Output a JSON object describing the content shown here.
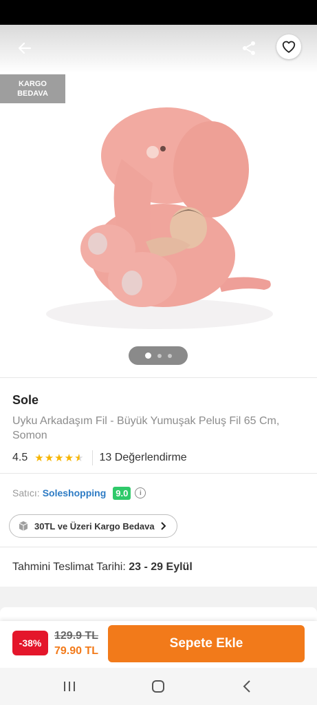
{
  "icons": {
    "back": "arrow-left-icon",
    "share": "share-icon",
    "favorite": "heart-icon",
    "cargo": "box-icon",
    "info": "info-icon"
  },
  "hero": {
    "badge_line1": "KARGO",
    "badge_line2": "BEDAVA",
    "image_count": 3,
    "active_image": 1
  },
  "product": {
    "brand": "Sole",
    "name": "Uyku Arkadaşım Fil - Büyük Yumuşak Peluş Fil 65 Cm, Somon",
    "rating": "4.5",
    "rating_value": 4.5,
    "reviews": "13 Değerlendirme"
  },
  "seller": {
    "label": "Satıcı:",
    "name": "Soleshopping",
    "score": "9.0"
  },
  "cargo_pill": "30TL ve Üzeri Kargo Bedava",
  "delivery": {
    "label": "Tahmini Teslimat Tarihi:",
    "dates": "23 - 29 Eylül"
  },
  "buybar": {
    "discount": "-38%",
    "old_price": "129.9 TL",
    "new_price": "79.90 TL",
    "add_to_cart": "Sepete Ekle"
  },
  "colors": {
    "accent": "#f27a1a",
    "discount": "#e4162b",
    "seller_link": "#2d7bc4",
    "score_badge": "#2fc96a",
    "star": "#f7b500"
  }
}
